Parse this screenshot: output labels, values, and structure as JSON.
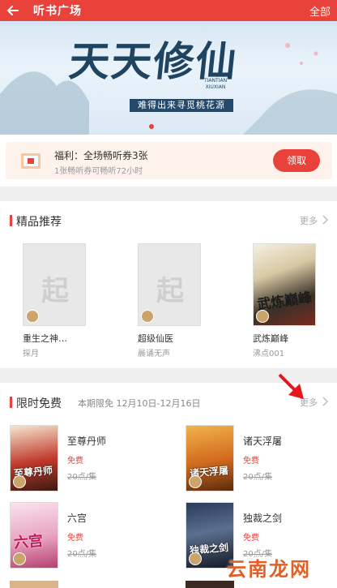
{
  "header": {
    "title": "听书广场",
    "right_label": "全部"
  },
  "banner": {
    "title": "天天修仙",
    "subtitle": "难得出来寻觅桃花源",
    "title_en_1": "TIANTIAN",
    "title_en_2": "XIUXIAN"
  },
  "coupon": {
    "title": "福利：全场畅听券3张",
    "desc": "1张畅听券可畅听72小时",
    "button": "领取"
  },
  "recommend": {
    "title": "精品推荐",
    "more": "更多",
    "books": [
      {
        "name": "重生之神…",
        "author": "探月"
      },
      {
        "name": "超级仙医",
        "author": "晨诵无声"
      },
      {
        "name": "武炼巅峰",
        "author": "沸点001",
        "cover_text": "武炼巅峰"
      }
    ]
  },
  "free": {
    "title": "限时免费",
    "period": "本期限免 12月10日-12月16日",
    "more": "更多",
    "items": [
      {
        "name": "至尊丹师",
        "tag": "免费",
        "price": "20点/集",
        "cover_text": "至尊丹师"
      },
      {
        "name": "诸天浮屠",
        "tag": "免费",
        "price": "20点/集",
        "cover_text": "诸天浮屠"
      },
      {
        "name": "六宫",
        "tag": "免费",
        "price": "20点/集",
        "cover_text": "六宫"
      },
      {
        "name": "独裁之剑",
        "tag": "免费",
        "price": "20点/集",
        "cover_text": "独裁之剑"
      }
    ]
  },
  "watermark": "云南龙网",
  "colors": {
    "accent": "#e8423a",
    "muted": "#999999"
  }
}
